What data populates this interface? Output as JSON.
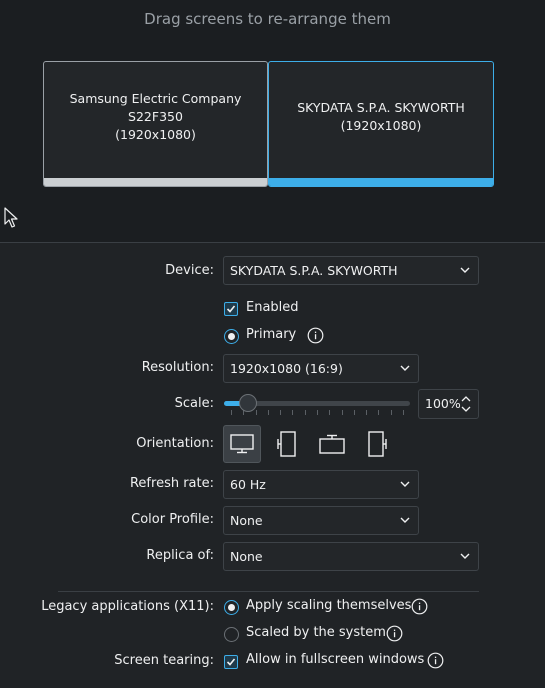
{
  "arrange": {
    "hint": "Drag screens to re-arrange them",
    "screens": [
      {
        "name": "Samsung Electric Company S22F350",
        "resolution": "(1920x1080)"
      },
      {
        "name": "SKYDATA S.P.A. SKYWORTH",
        "resolution": "(1920x1080)"
      }
    ]
  },
  "settings": {
    "device_label": "Device:",
    "device_value": "SKYDATA S.P.A. SKYWORTH",
    "enabled_label": "Enabled",
    "primary_label": "Primary",
    "resolution_label": "Resolution:",
    "resolution_value": "1920x1080 (16:9)",
    "scale_label": "Scale:",
    "scale_value": "100%",
    "scale_level": 0.1,
    "orientation_label": "Orientation:",
    "refresh_label": "Refresh rate:",
    "refresh_value": "60 Hz",
    "color_profile_label": "Color Profile:",
    "color_profile_value": "None",
    "replica_label": "Replica of:",
    "replica_value": "None",
    "legacy_label": "Legacy applications (X11):",
    "legacy_opt1": "Apply scaling themselves",
    "legacy_opt2": "Scaled by the system",
    "tearing_label": "Screen tearing:",
    "tearing_opt": "Allow in fullscreen windows"
  },
  "icons": {
    "orientation": [
      "monitor-landscape-icon",
      "monitor-portrait-left-icon",
      "monitor-landscape-flipped-icon",
      "monitor-portrait-right-icon"
    ],
    "info": "info-icon",
    "chevron": "chevron-down-icon",
    "cursor": "mouse-cursor-icon"
  },
  "colors": {
    "accent": "#3daee9",
    "background": "#202326",
    "text": "#eff0f1"
  }
}
